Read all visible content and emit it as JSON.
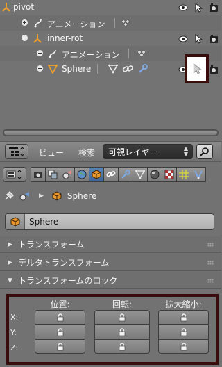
{
  "outliner": {
    "rows": [
      {
        "label": "pivot"
      },
      {
        "label": "アニメーション"
      },
      {
        "label": "inner-rot"
      },
      {
        "label": "アニメーション"
      },
      {
        "label": "Sphere"
      }
    ]
  },
  "header": {
    "view_menu": "ビュー",
    "search_menu": "検索",
    "filter_dropdown": "可視レイヤー"
  },
  "properties": {
    "breadcrumb_object": "Sphere",
    "object_name_value": "Sphere",
    "panels": [
      {
        "title": "トランスフォーム",
        "expanded": false
      },
      {
        "title": "デルタトランスフォーム",
        "expanded": false
      },
      {
        "title": "トランスフォームのロック",
        "expanded": true
      }
    ],
    "lock": {
      "columns": [
        "位置:",
        "回転:",
        "拡大縮小:"
      ],
      "axes": [
        "X:",
        "Y:",
        "Z:"
      ]
    }
  },
  "colors": {
    "highlight_border": "#3a0d0d",
    "active_tab": "#4a74a6",
    "object_orange": "#e8952c"
  }
}
